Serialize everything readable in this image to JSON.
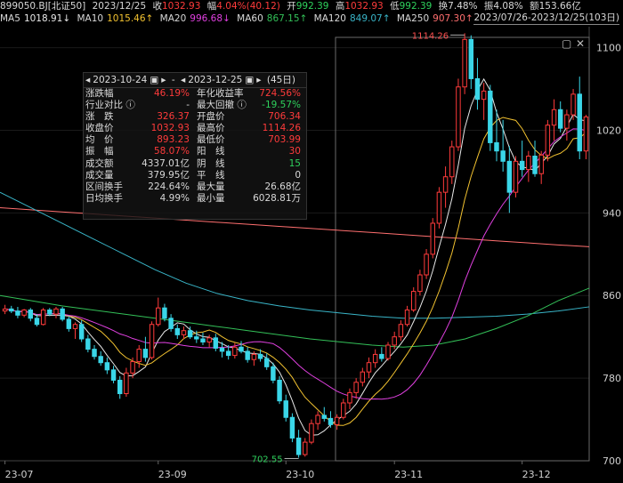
{
  "header": {
    "code": "899050.BJ[北证50]",
    "date": "2023/12/25",
    "close_label": "收",
    "close": "1032.93",
    "pct_label": "幅",
    "pct": "4.04%(40.12)",
    "open_label": "开",
    "open": "992.39",
    "high_label": "高",
    "high": "1032.93",
    "low_label": "低",
    "low": "992.39",
    "turnover_label": "换",
    "turnover": "7.48%",
    "amplitude_label": "振",
    "amplitude": "4.08%",
    "amount_label": "额",
    "amount": "153.66亿"
  },
  "ma": [
    {
      "label": "MA5",
      "value": "1018.91↓",
      "color": "#e8e8e8"
    },
    {
      "label": "MA10",
      "value": "1015.46↑",
      "color": "#f2c230"
    },
    {
      "label": "MA20",
      "value": "996.68↓",
      "color": "#e040e0"
    },
    {
      "label": "MA60",
      "value": "867.15↑",
      "color": "#33c058"
    },
    {
      "label": "MA120",
      "value": "849.07↑",
      "color": "#39b5c8"
    },
    {
      "label": "MA250",
      "value": "907.30↑",
      "color": "#ff6f6f"
    }
  ],
  "range_label": "2023/07/26-2023/12/25(103日)",
  "panel": {
    "start": "2023-10-24",
    "end": "2023-12-25",
    "days": "(45日)",
    "rows": [
      {
        "k1": "涨跌幅",
        "v1": "46.19%",
        "c1": "r",
        "k2": "年化收益率",
        "v2": "724.56%",
        "c2": "r"
      },
      {
        "k1": "行业对比 ⓘ",
        "v1": "-",
        "c1": "w",
        "k2": "最大回撤 ⓘ",
        "v2": "-19.57%",
        "c2": "g"
      },
      {
        "k1": "涨　跌",
        "v1": "326.37",
        "c1": "r",
        "k2": "开盘价",
        "v2": "706.34",
        "c2": "r"
      },
      {
        "k1": "收盘价",
        "v1": "1032.93",
        "c1": "r",
        "k2": "最高价",
        "v2": "1114.26",
        "c2": "r"
      },
      {
        "k1": "均　价",
        "v1": "893.23",
        "c1": "r",
        "k2": "最低价",
        "v2": "703.99",
        "c2": "r"
      },
      {
        "k1": "振　幅",
        "v1": "58.07%",
        "c1": "r",
        "k2": "阳　线",
        "v2": "30",
        "c2": "r"
      },
      {
        "k1": "成交额",
        "v1": "4337.01亿",
        "c1": "w",
        "k2": "阴　线",
        "v2": "15",
        "c2": "g"
      },
      {
        "k1": "成交量",
        "v1": "379.95亿",
        "c1": "w",
        "k2": "平　线",
        "v2": "0",
        "c2": "w"
      },
      {
        "k1": "区间换手",
        "v1": "224.64%",
        "c1": "w",
        "k2": "最大量",
        "v2": "26.68亿",
        "c2": "w"
      },
      {
        "k1": "日均换手",
        "v1": "4.99%",
        "c1": "w",
        "k2": "最小量",
        "v2": "6028.81万",
        "c2": "w"
      }
    ]
  },
  "chart_data": {
    "type": "candlestick",
    "y_ticks": [
      "1100",
      "1020",
      "940",
      "860",
      "780",
      "700"
    ],
    "x_ticks": [
      "23-07",
      "23-09",
      "23-10",
      "23-11",
      "23-12"
    ],
    "ylim": [
      700,
      1110
    ],
    "high_marker": "1114.26",
    "low_marker": "702.55",
    "colors": {
      "up": "#ff3b3b",
      "down": "#3ad6e8",
      "grid": "#1c1c1c"
    },
    "candles": [
      [
        845,
        851,
        842,
        847
      ],
      [
        847,
        850,
        843,
        845
      ],
      [
        845,
        849,
        838,
        841
      ],
      [
        841,
        847,
        839,
        846
      ],
      [
        846,
        848,
        835,
        838
      ],
      [
        838,
        842,
        830,
        832
      ],
      [
        832,
        848,
        831,
        846
      ],
      [
        846,
        848,
        840,
        842
      ],
      [
        842,
        849,
        838,
        847
      ],
      [
        847,
        849,
        835,
        837
      ],
      [
        837,
        840,
        825,
        828
      ],
      [
        828,
        834,
        818,
        832
      ],
      [
        832,
        836,
        815,
        818
      ],
      [
        818,
        822,
        805,
        808
      ],
      [
        808,
        812,
        798,
        801
      ],
      [
        801,
        806,
        792,
        795
      ],
      [
        795,
        800,
        784,
        788
      ],
      [
        788,
        792,
        775,
        778
      ],
      [
        778,
        782,
        760,
        765
      ],
      [
        765,
        790,
        762,
        785
      ],
      [
        785,
        800,
        780,
        796
      ],
      [
        796,
        812,
        790,
        808
      ],
      [
        808,
        820,
        796,
        800
      ],
      [
        800,
        835,
        798,
        832
      ],
      [
        832,
        858,
        830,
        848
      ],
      [
        848,
        852,
        835,
        838
      ],
      [
        838,
        842,
        825,
        828
      ],
      [
        828,
        832,
        818,
        822
      ],
      [
        822,
        830,
        818,
        826
      ],
      [
        826,
        830,
        818,
        820
      ],
      [
        820,
        826,
        814,
        818
      ],
      [
        818,
        824,
        812,
        815
      ],
      [
        815,
        822,
        810,
        819
      ],
      [
        819,
        823,
        806,
        809
      ],
      [
        809,
        815,
        800,
        806
      ],
      [
        806,
        812,
        798,
        802
      ],
      [
        802,
        814,
        799,
        810
      ],
      [
        810,
        816,
        804,
        806
      ],
      [
        806,
        810,
        795,
        798
      ],
      [
        798,
        806,
        792,
        803
      ],
      [
        803,
        808,
        796,
        799
      ],
      [
        799,
        804,
        788,
        791
      ],
      [
        791,
        795,
        775,
        778
      ],
      [
        778,
        782,
        755,
        758
      ],
      [
        758,
        764,
        738,
        742
      ],
      [
        742,
        746,
        718,
        722
      ],
      [
        722,
        730,
        703,
        706
      ],
      [
        706,
        722,
        704,
        718
      ],
      [
        718,
        740,
        716,
        736
      ],
      [
        736,
        748,
        730,
        744
      ],
      [
        744,
        752,
        738,
        741
      ],
      [
        741,
        748,
        732,
        735
      ],
      [
        735,
        745,
        730,
        742
      ],
      [
        742,
        760,
        740,
        756
      ],
      [
        756,
        770,
        750,
        766
      ],
      [
        766,
        780,
        760,
        776
      ],
      [
        776,
        790,
        772,
        786
      ],
      [
        786,
        800,
        780,
        795
      ],
      [
        795,
        808,
        790,
        803
      ],
      [
        803,
        810,
        796,
        799
      ],
      [
        799,
        815,
        797,
        812
      ],
      [
        812,
        825,
        808,
        820
      ],
      [
        820,
        836,
        816,
        832
      ],
      [
        832,
        850,
        830,
        846
      ],
      [
        846,
        868,
        844,
        864
      ],
      [
        864,
        885,
        860,
        880
      ],
      [
        880,
        905,
        876,
        900
      ],
      [
        900,
        935,
        896,
        930
      ],
      [
        930,
        965,
        925,
        960
      ],
      [
        960,
        985,
        945,
        975
      ],
      [
        975,
        1010,
        968,
        1004
      ],
      [
        1004,
        1070,
        1000,
        1062
      ],
      [
        1062,
        1114,
        1055,
        1108
      ],
      [
        1108,
        1112,
        1060,
        1070
      ],
      [
        1070,
        1090,
        1040,
        1050
      ],
      [
        1050,
        1066,
        1030,
        1058
      ],
      [
        1058,
        1064,
        1000,
        1008
      ],
      [
        1008,
        1040,
        990,
        1000
      ],
      [
        1000,
        1030,
        980,
        990
      ],
      [
        990,
        1005,
        940,
        960
      ],
      [
        960,
        995,
        955,
        990
      ],
      [
        990,
        1010,
        975,
        982
      ],
      [
        982,
        1000,
        970,
        995
      ],
      [
        995,
        1010,
        975,
        978
      ],
      [
        978,
        1000,
        968,
        996
      ],
      [
        996,
        1030,
        990,
        1025
      ],
      [
        1025,
        1050,
        1010,
        1040
      ],
      [
        1040,
        1048,
        1018,
        1022
      ],
      [
        1022,
        1040,
        1010,
        1035
      ],
      [
        1035,
        1060,
        1030,
        1055
      ],
      [
        1055,
        1072,
        992,
        1000
      ],
      [
        1000,
        1035,
        992,
        1032.93
      ]
    ],
    "series": [
      {
        "name": "MA250",
        "values": [
          945,
          943,
          941,
          939,
          937,
          935,
          933,
          931,
          929,
          927,
          925,
          923,
          921,
          919,
          917,
          915,
          913,
          911,
          909,
          907.3
        ]
      },
      {
        "name": "MA120",
        "values": [
          960,
          945,
          930,
          915,
          900,
          885,
          872,
          862,
          855,
          850,
          846,
          843,
          840,
          838,
          838,
          839,
          840,
          842,
          845,
          849.07
        ]
      },
      {
        "name": "MA60",
        "values": [
          860,
          855,
          850,
          846,
          842,
          838,
          834,
          830,
          826,
          822,
          818,
          815,
          812,
          810,
          812,
          818,
          828,
          840,
          855,
          867.15
        ]
      }
    ]
  }
}
